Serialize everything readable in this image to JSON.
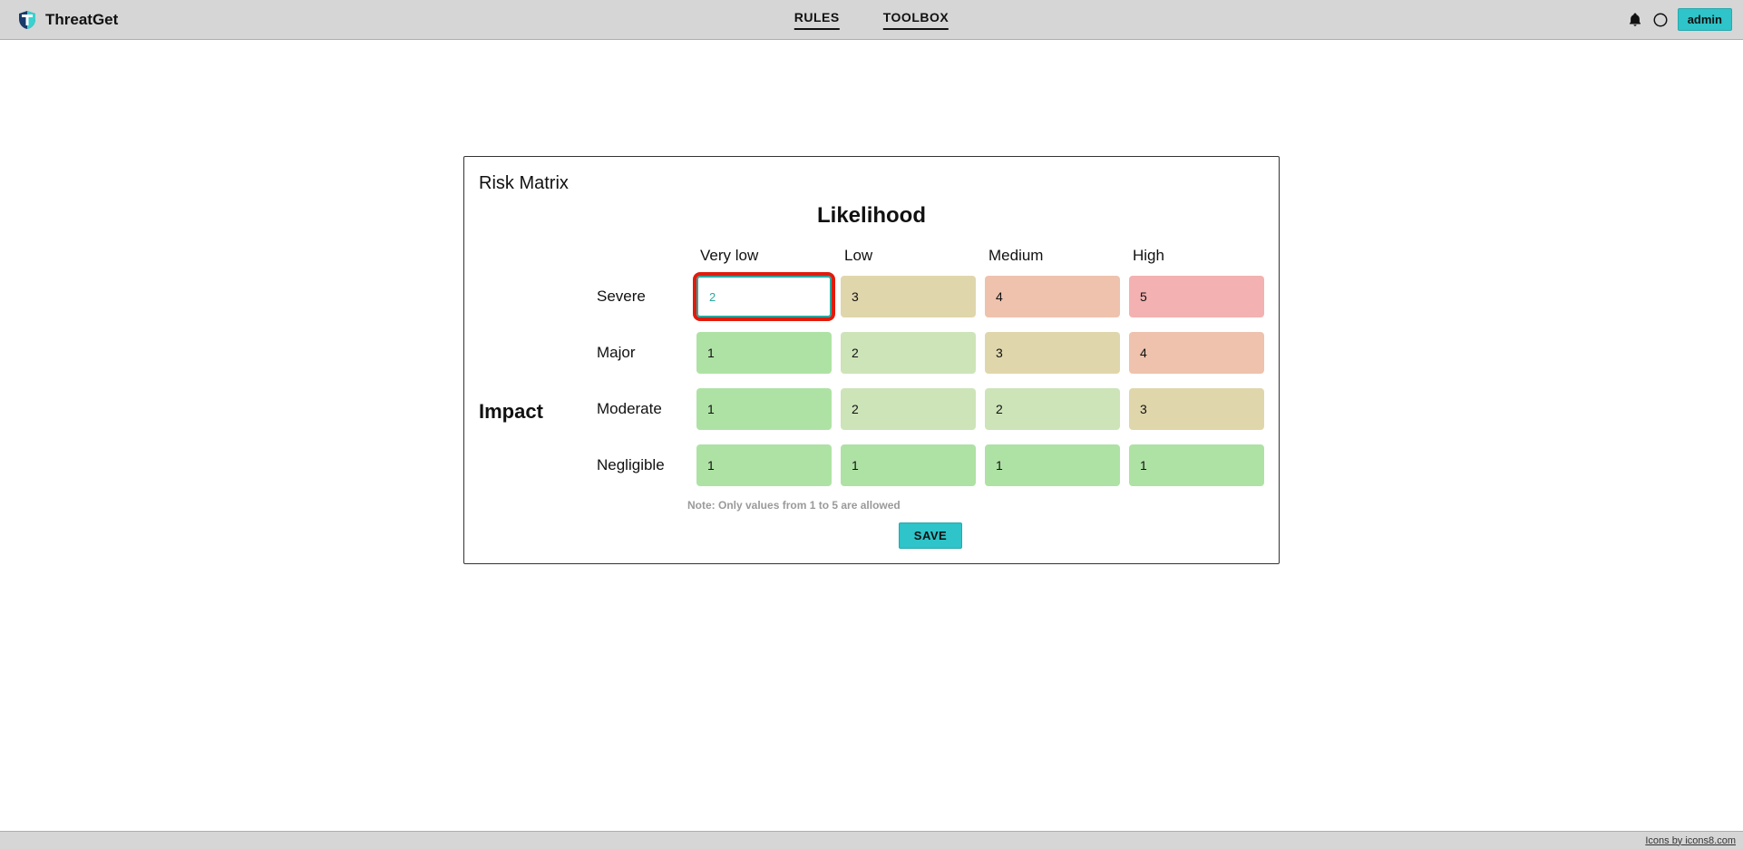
{
  "app": {
    "name": "ThreatGet"
  },
  "nav": {
    "rules": "RULES",
    "toolbox": "TOOLBOX"
  },
  "user": {
    "label": "admin"
  },
  "card": {
    "title": "Risk Matrix",
    "likelihood_title": "Likelihood",
    "impact_title": "Impact",
    "note": "Note: Only values from 1 to 5 are allowed",
    "save_label": "SAVE"
  },
  "likelihood_headers": [
    "Very low",
    "Low",
    "Medium",
    "High"
  ],
  "impact_labels": [
    "Severe",
    "Major",
    "Moderate",
    "Negligible"
  ],
  "matrix": [
    [
      {
        "v": "2",
        "active": true
      },
      {
        "v": "3"
      },
      {
        "v": "4"
      },
      {
        "v": "5"
      }
    ],
    [
      {
        "v": "1"
      },
      {
        "v": "2"
      },
      {
        "v": "3"
      },
      {
        "v": "4"
      }
    ],
    [
      {
        "v": "1"
      },
      {
        "v": "2"
      },
      {
        "v": "2"
      },
      {
        "v": "3"
      }
    ],
    [
      {
        "v": "1"
      },
      {
        "v": "1"
      },
      {
        "v": "1"
      },
      {
        "v": "1"
      }
    ]
  ],
  "colors": {
    "1": "#aee2a4",
    "2": "#cde4b8",
    "3": "#e0d6ac",
    "4": "#eec2ad",
    "5": "#f3b1b1"
  },
  "footer": {
    "credit": "Icons by icons8.com"
  }
}
